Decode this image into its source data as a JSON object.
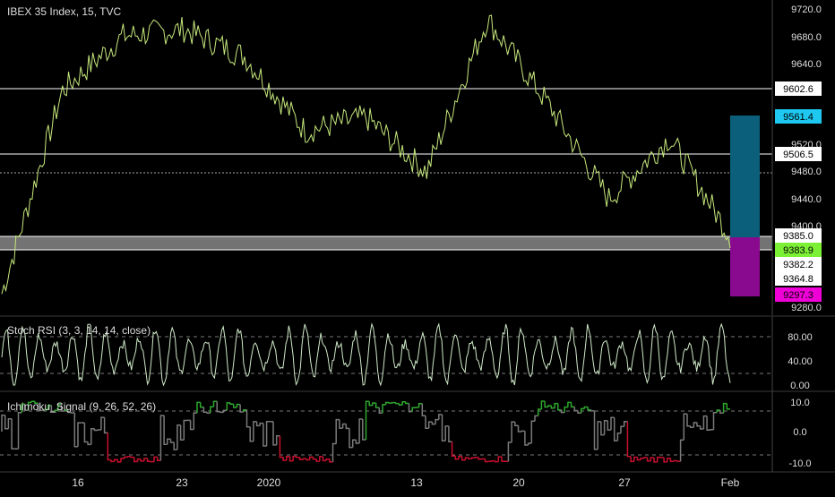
{
  "colors": {
    "background": "#000000",
    "price_line": "#c6e87c",
    "white_level": "#ffffff",
    "gray_zone": "#888888",
    "target_box": "#0c5f7a",
    "stop_box": "#8a0a8f",
    "stoch_line": "#cfe9c8",
    "ichi_up": "#2ea82e",
    "ichi_down": "#c8102e",
    "ichi_neutral": "#7a7a7a",
    "green_label": "#7cf035",
    "cyan_label": "#1ec8f0",
    "magenta_label": "#ef00d7",
    "axis_text": "#dddddd"
  },
  "header": {
    "title": "IBEX 35 Index, 15, TVC"
  },
  "price_axis": {
    "ticks": [
      "9720.0",
      "9680.0",
      "9640.0",
      "9600.0",
      "9560.0",
      "9520.0",
      "9480.0",
      "9440.0",
      "9400.0",
      "9280.0"
    ]
  },
  "price_labels": {
    "level_1": "9602.6",
    "target": "9561.4",
    "level_2": "9506.5",
    "entry": "9385.0",
    "current": "9383.9",
    "level_3": "9382.2",
    "level_4": "9364.8",
    "stop": "9297.3"
  },
  "stoch_panel": {
    "title": "Stoch RSI (3, 3, 14, 14, close)",
    "ticks": [
      "80.00",
      "40.00",
      "0.00"
    ]
  },
  "ichi_panel": {
    "title": "Ichimoku_Signal (9, 26, 52, 26)",
    "ticks": [
      "10.0",
      "0.0",
      "-10.0"
    ]
  },
  "time_axis": {
    "labels": [
      "16",
      "23",
      "2020",
      "13",
      "20",
      "27",
      "Feb"
    ]
  },
  "chart_data": [
    {
      "type": "line",
      "title": "IBEX 35 Index, 15, TVC",
      "series": [
        {
          "x": [
            "16",
            "",
            "23",
            "",
            "2020",
            "",
            "13",
            "",
            "20",
            "",
            "27",
            "",
            "Feb"
          ],
          "values": [
            9300,
            9600,
            9680,
            9690,
            9650,
            9540,
            9560,
            9480,
            9705,
            9580,
            9440,
            9530,
            9385
          ]
        }
      ],
      "ylim": [
        9270,
        9730
      ],
      "horizontal_levels": [
        9602.6,
        9506.5,
        9385.0,
        9383.9,
        9382.2,
        9364.8
      ],
      "target_price": 9561.4,
      "stop_price": 9297.3
    },
    {
      "type": "line",
      "title": "Stoch RSI (3, 3, 14, 14, close)",
      "ylim": [
        0,
        100
      ],
      "reference_levels": [
        80,
        20
      ]
    },
    {
      "type": "line",
      "title": "Ichimoku_Signal (9, 26, 52, 26)",
      "ylim": [
        -11,
        11
      ],
      "reference_levels": [
        8,
        -8
      ]
    }
  ]
}
